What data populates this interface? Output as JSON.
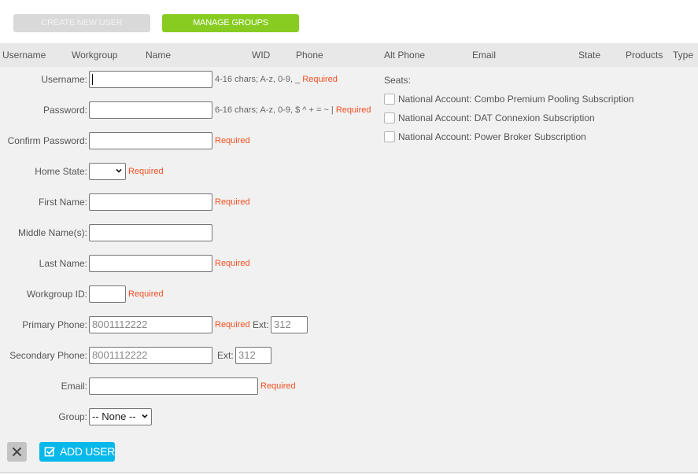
{
  "toolbar": {
    "create_new_user": "CREATE NEW USER",
    "manage_groups": "MANAGE GROUPS"
  },
  "table_header": {
    "columns": [
      "Username",
      "Workgroup",
      "Name",
      "WID",
      "Phone",
      "Alt Phone",
      "Email",
      "State",
      "Products",
      "Type"
    ]
  },
  "form": {
    "username": {
      "label": "Username:",
      "value": "",
      "hint": "4-16 chars; A-z, 0-9, _ ",
      "required": "Required"
    },
    "password": {
      "label": "Password:",
      "value": "",
      "hint": "6-16 chars; A-z, 0-9, $ ^ + = ~ | ",
      "required": "Required"
    },
    "confirm_password": {
      "label": "Confirm Password:",
      "value": "",
      "required": "Required"
    },
    "home_state": {
      "label": "Home State:",
      "value": "",
      "required": "Required"
    },
    "first_name": {
      "label": "First Name:",
      "value": "",
      "required": "Required"
    },
    "middle_names": {
      "label": "Middle Name(s):",
      "value": ""
    },
    "last_name": {
      "label": "Last Name:",
      "value": "",
      "required": "Required"
    },
    "workgroup_id": {
      "label": "Workgroup ID:",
      "value": "",
      "required": "Required"
    },
    "primary_phone": {
      "label": "Primary Phone:",
      "placeholder": "8001112222",
      "required": "Required",
      "ext_label": "Ext:",
      "ext_placeholder": "312"
    },
    "secondary_phone": {
      "label": "Secondary Phone:",
      "placeholder": "8001112222",
      "ext_label": "Ext:",
      "ext_placeholder": "312"
    },
    "email": {
      "label": "Email:",
      "value": "",
      "required": "Required"
    },
    "group": {
      "label": "Group:",
      "selected": "-- None --"
    }
  },
  "seats": {
    "title": "Seats:",
    "items": [
      {
        "label": "National Account: Combo Premium Pooling Subscription",
        "checked": false
      },
      {
        "label": "National Account: DAT Connexion Subscription",
        "checked": false
      },
      {
        "label": "National Account: Power Broker Subscription",
        "checked": false
      }
    ]
  },
  "actions": {
    "cancel_icon": "close-icon",
    "add_user": "ADD USER",
    "add_user_icon": "checkbox-checked-icon"
  },
  "colors": {
    "manage_groups_bg": "#88cc22",
    "create_user_bg": "#d9d9d9",
    "required": "#f05022",
    "add_user_bg": "#08b8ea"
  }
}
